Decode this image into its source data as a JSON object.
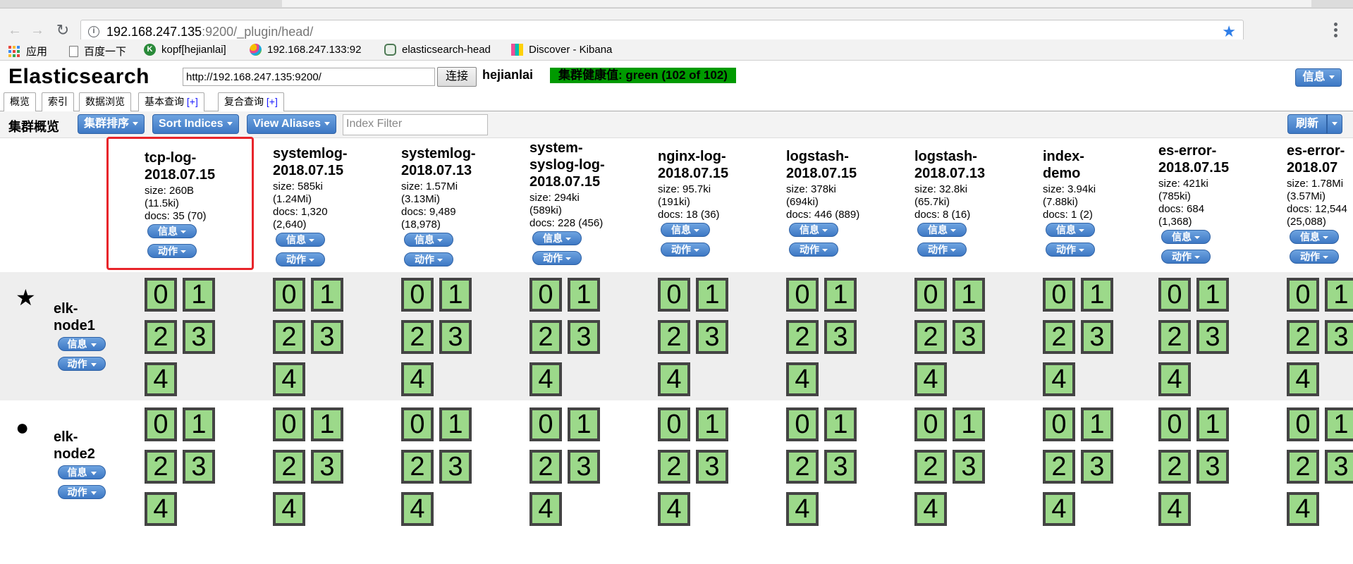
{
  "browser": {
    "url_host": "192.168.247.135",
    "url_rest": ":9200/_plugin/head/",
    "bookmarks": [
      "应用",
      "百度一下",
      "kopf[hejianlai]",
      "192.168.247.133:92",
      "elasticsearch-head",
      "Discover - Kibana"
    ]
  },
  "header": {
    "title": "Elasticsearch",
    "connect_url": "http://192.168.247.135:9200/",
    "connect_label": "连接",
    "cluster_name": "hejianlai",
    "health": "集群健康值: green (102 of 102)",
    "info_label": "信息"
  },
  "tabs": [
    {
      "label": "概览"
    },
    {
      "label": "索引"
    },
    {
      "label": "数据浏览"
    },
    {
      "label": "基本查询",
      "plus": "[+]"
    },
    {
      "label": "复合查询",
      "plus": "[+]"
    }
  ],
  "overview": {
    "title": "集群概览",
    "sort_cluster": "集群排序",
    "sort_indices": "Sort Indices",
    "view_aliases": "View Aliases",
    "filter_placeholder": "Index Filter",
    "refresh": "刷新"
  },
  "buttons": {
    "info": "信息",
    "action": "动作"
  },
  "indices": [
    {
      "name1": "tcp-log-",
      "name2": "2018.07.15",
      "name3": "",
      "size1": "size: 260B",
      "size2": "(11.5ki)",
      "docs1": "docs: 35 (70)",
      "docs2": ""
    },
    {
      "name1": "systemlog-",
      "name2": "2018.07.15",
      "name3": "",
      "size1": "size: 585ki",
      "size2": "(1.24Mi)",
      "docs1": "docs: 1,320",
      "docs2": "(2,640)"
    },
    {
      "name1": "systemlog-",
      "name2": "2018.07.13",
      "name3": "",
      "size1": "size: 1.57Mi",
      "size2": "(3.13Mi)",
      "docs1": "docs: 9,489",
      "docs2": "(18,978)"
    },
    {
      "name1": "system-",
      "name2": "syslog-log-",
      "name3": "2018.07.15",
      "size1": "size: 294ki",
      "size2": "(589ki)",
      "docs1": "docs: 228 (456)",
      "docs2": ""
    },
    {
      "name1": "nginx-log-",
      "name2": "2018.07.15",
      "name3": "",
      "size1": "size: 95.7ki",
      "size2": "(191ki)",
      "docs1": "docs: 18 (36)",
      "docs2": ""
    },
    {
      "name1": "logstash-",
      "name2": "2018.07.15",
      "name3": "",
      "size1": "size: 378ki",
      "size2": "(694ki)",
      "docs1": "docs: 446 (889)",
      "docs2": ""
    },
    {
      "name1": "logstash-",
      "name2": "2018.07.13",
      "name3": "",
      "size1": "size: 32.8ki",
      "size2": "(65.7ki)",
      "docs1": "docs: 8 (16)",
      "docs2": ""
    },
    {
      "name1": "index-",
      "name2": "demo",
      "name3": "",
      "size1": "size: 3.94ki",
      "size2": "(7.88ki)",
      "docs1": "docs: 1 (2)",
      "docs2": ""
    },
    {
      "name1": "es-error-",
      "name2": "2018.07.15",
      "name3": "",
      "size1": "size: 421ki",
      "size2": "(785ki)",
      "docs1": "docs: 684",
      "docs2": "(1,368)"
    },
    {
      "name1": "es-error-",
      "name2": "2018.07",
      "name3": "",
      "size1": "size: 1.78Mi",
      "size2": "(3.57Mi)",
      "docs1": "docs: 12,544",
      "docs2": "(25,088)"
    }
  ],
  "nodes": [
    {
      "name1": "elk-",
      "name2": "node1",
      "marker": "★"
    },
    {
      "name1": "elk-",
      "name2": "node2",
      "marker": "●"
    }
  ],
  "shard_labels": [
    "0",
    "1",
    "2",
    "3",
    "4"
  ]
}
